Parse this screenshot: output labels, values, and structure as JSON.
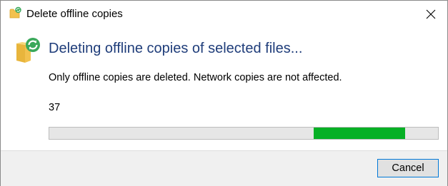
{
  "window": {
    "title": "Delete offline copies",
    "icon": "offline-folder-sync-icon"
  },
  "content": {
    "heading": "Deleting offline copies of selected files...",
    "description": "Only offline copies are deleted.  Network copies are not affected.",
    "count": "37",
    "progress": {
      "mode": "marquee",
      "segment_start_fraction": 0.68,
      "segment_end_fraction": 0.915,
      "color": "#06b025"
    }
  },
  "footer": {
    "cancel_label": "Cancel"
  },
  "colors": {
    "heading": "#1f3d7a",
    "button_border": "#0078d7",
    "footer_bg": "#f0f0f0"
  }
}
